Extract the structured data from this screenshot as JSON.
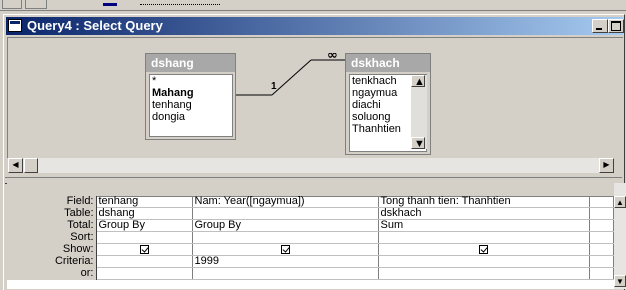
{
  "window": {
    "title": "Query4 : Select Query"
  },
  "tables": [
    {
      "name": "dshang",
      "fields": [
        "*",
        "Mahang",
        "tenhang",
        "dongia"
      ],
      "bold_field": "Mahang"
    },
    {
      "name": "dskhach",
      "fields": [
        "tenkhach",
        "ngaymua",
        "diachi",
        "soluong",
        "Thanhtien"
      ]
    }
  ],
  "relationship": {
    "one_label": "1",
    "many_label": "∞"
  },
  "grid": {
    "row_labels": [
      "Field:",
      "Table:",
      "Total:",
      "Sort:",
      "Show:",
      "Criteria:",
      "or:"
    ],
    "columns": [
      {
        "field": "tenhang",
        "table": "dshang",
        "total": "Group By",
        "sort": "",
        "show": true,
        "criteria": "",
        "or": ""
      },
      {
        "field": "Nam: Year([ngaymua])",
        "table": "",
        "total": "Group By",
        "sort": "",
        "show": true,
        "criteria": "1999",
        "or": ""
      },
      {
        "field": "Tong thanh tien: Thanhtien",
        "table": "dskhach",
        "total": "Sum",
        "sort": "",
        "show": true,
        "criteria": "",
        "or": ""
      },
      {
        "field": "",
        "table": "",
        "total": "",
        "sort": "",
        "show": false,
        "criteria": "",
        "or": ""
      }
    ]
  },
  "icons": {
    "title": "query-window-icon",
    "minimize": "minimize-icon",
    "maximize": "maximize-icon"
  }
}
